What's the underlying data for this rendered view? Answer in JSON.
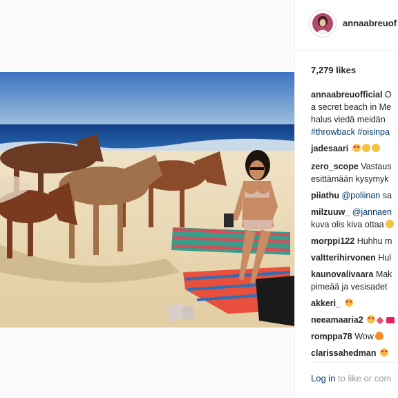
{
  "header": {
    "username": "annaabreuof"
  },
  "post": {
    "likes": "7,279 likes",
    "caption": {
      "user": "annaabreuofficial",
      "line1": " O",
      "line2": "a secret beach in Me",
      "line3": "halus viedä meidän",
      "tags": "#throwback #oisinpa"
    },
    "comments": [
      {
        "user": "jadesaari",
        "text": "",
        "emoji": [
          "heart-eyes",
          "smile",
          "smile"
        ]
      },
      {
        "user": "zero_scope",
        "text": " Vastaus",
        "line2": "esittämään kysymyk",
        "emoji": []
      },
      {
        "user": "piiathu",
        "mention": " @poliinan",
        "text": " sa",
        "emoji": []
      },
      {
        "user": "milzuuw_",
        "mention": " @jannaen",
        "line2": "kuva olis kiva ottaa",
        "emoji": [
          "smile"
        ]
      },
      {
        "user": "morppi122",
        "text": " Huhhu m",
        "emoji": []
      },
      {
        "user": "valtterihirvonen",
        "text": " Hul",
        "emoji": []
      },
      {
        "user": "kaunovalivaara",
        "text": " Mak",
        "line2": "pimeää ja vesisadet",
        "emoji": []
      },
      {
        "user": "akkeri_",
        "text": "",
        "emoji": [
          "heart-eyes"
        ]
      },
      {
        "user": "neeamaaria2",
        "text": "",
        "emoji": [
          "heart-eyes",
          "heart",
          "sos"
        ]
      },
      {
        "user": "romppa78",
        "text": " Wow",
        "emoji": [
          "fire"
        ]
      },
      {
        "user": "clarissahedman",
        "text": "",
        "emoji": [
          "heart-eyes"
        ]
      }
    ]
  },
  "footer": {
    "login_link": "Log in",
    "login_text": " to like or com"
  },
  "colors": {
    "link": "#003569",
    "sky": "#3a6fb5",
    "sea": "#1d4f9a",
    "sand": "#e9d8b6"
  }
}
